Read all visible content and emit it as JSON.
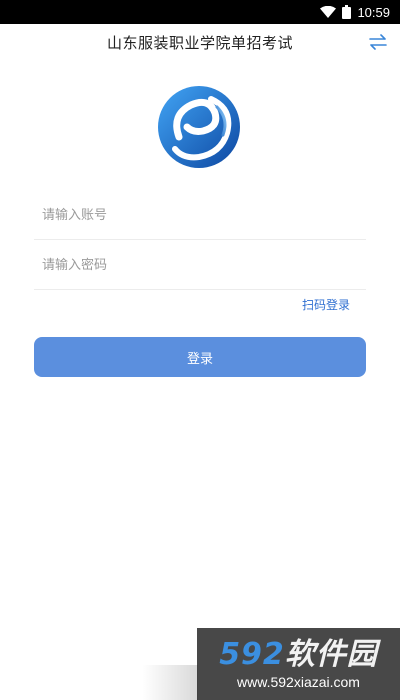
{
  "status_bar": {
    "time": "10:59",
    "icons": [
      "wifi-icon",
      "battery-icon"
    ]
  },
  "app_bar": {
    "title": "山东服装职业学院单招考试",
    "action_icon": "swap-arrows-icon"
  },
  "logo": {
    "icon": "school-logo-icon",
    "colors": [
      "#1565c0",
      "#42a5f5",
      "#0d47a1"
    ]
  },
  "form": {
    "account_placeholder": "请输入账号",
    "password_placeholder": "请输入密码",
    "qr_login_label": "扫码登录",
    "login_label": "登录"
  },
  "colors": {
    "accent": "#5b8fde",
    "link": "#2f6fd1"
  },
  "watermark": {
    "brand_num": "592",
    "brand_text": "软件园",
    "url": "www.592xiazai.com"
  }
}
